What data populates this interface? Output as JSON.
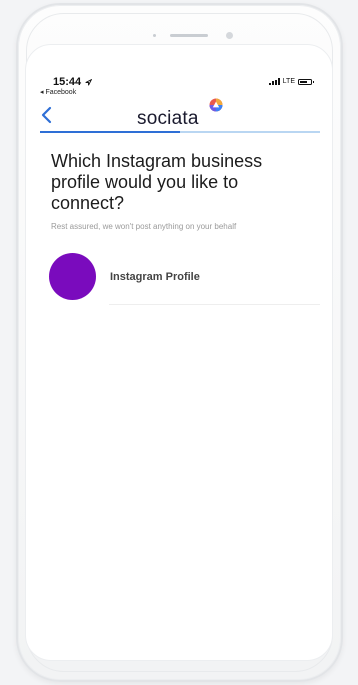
{
  "status_bar": {
    "time": "15:44",
    "back_app": "◂ Facebook",
    "network": "LTE"
  },
  "header": {
    "brand": "sociata",
    "back_icon": "chevron-left-icon"
  },
  "progress": {
    "fraction": 0.5
  },
  "content": {
    "question": "Which Instagram business profile would you like to connect?",
    "subtitle": "Rest assured, we won't post anything on your behalf"
  },
  "profiles": [
    {
      "name": "Instagram Profile",
      "avatar_color": "#7a0bbd"
    }
  ],
  "colors": {
    "accent": "#2e6fd6",
    "progress_track": "#b9d6f2"
  }
}
